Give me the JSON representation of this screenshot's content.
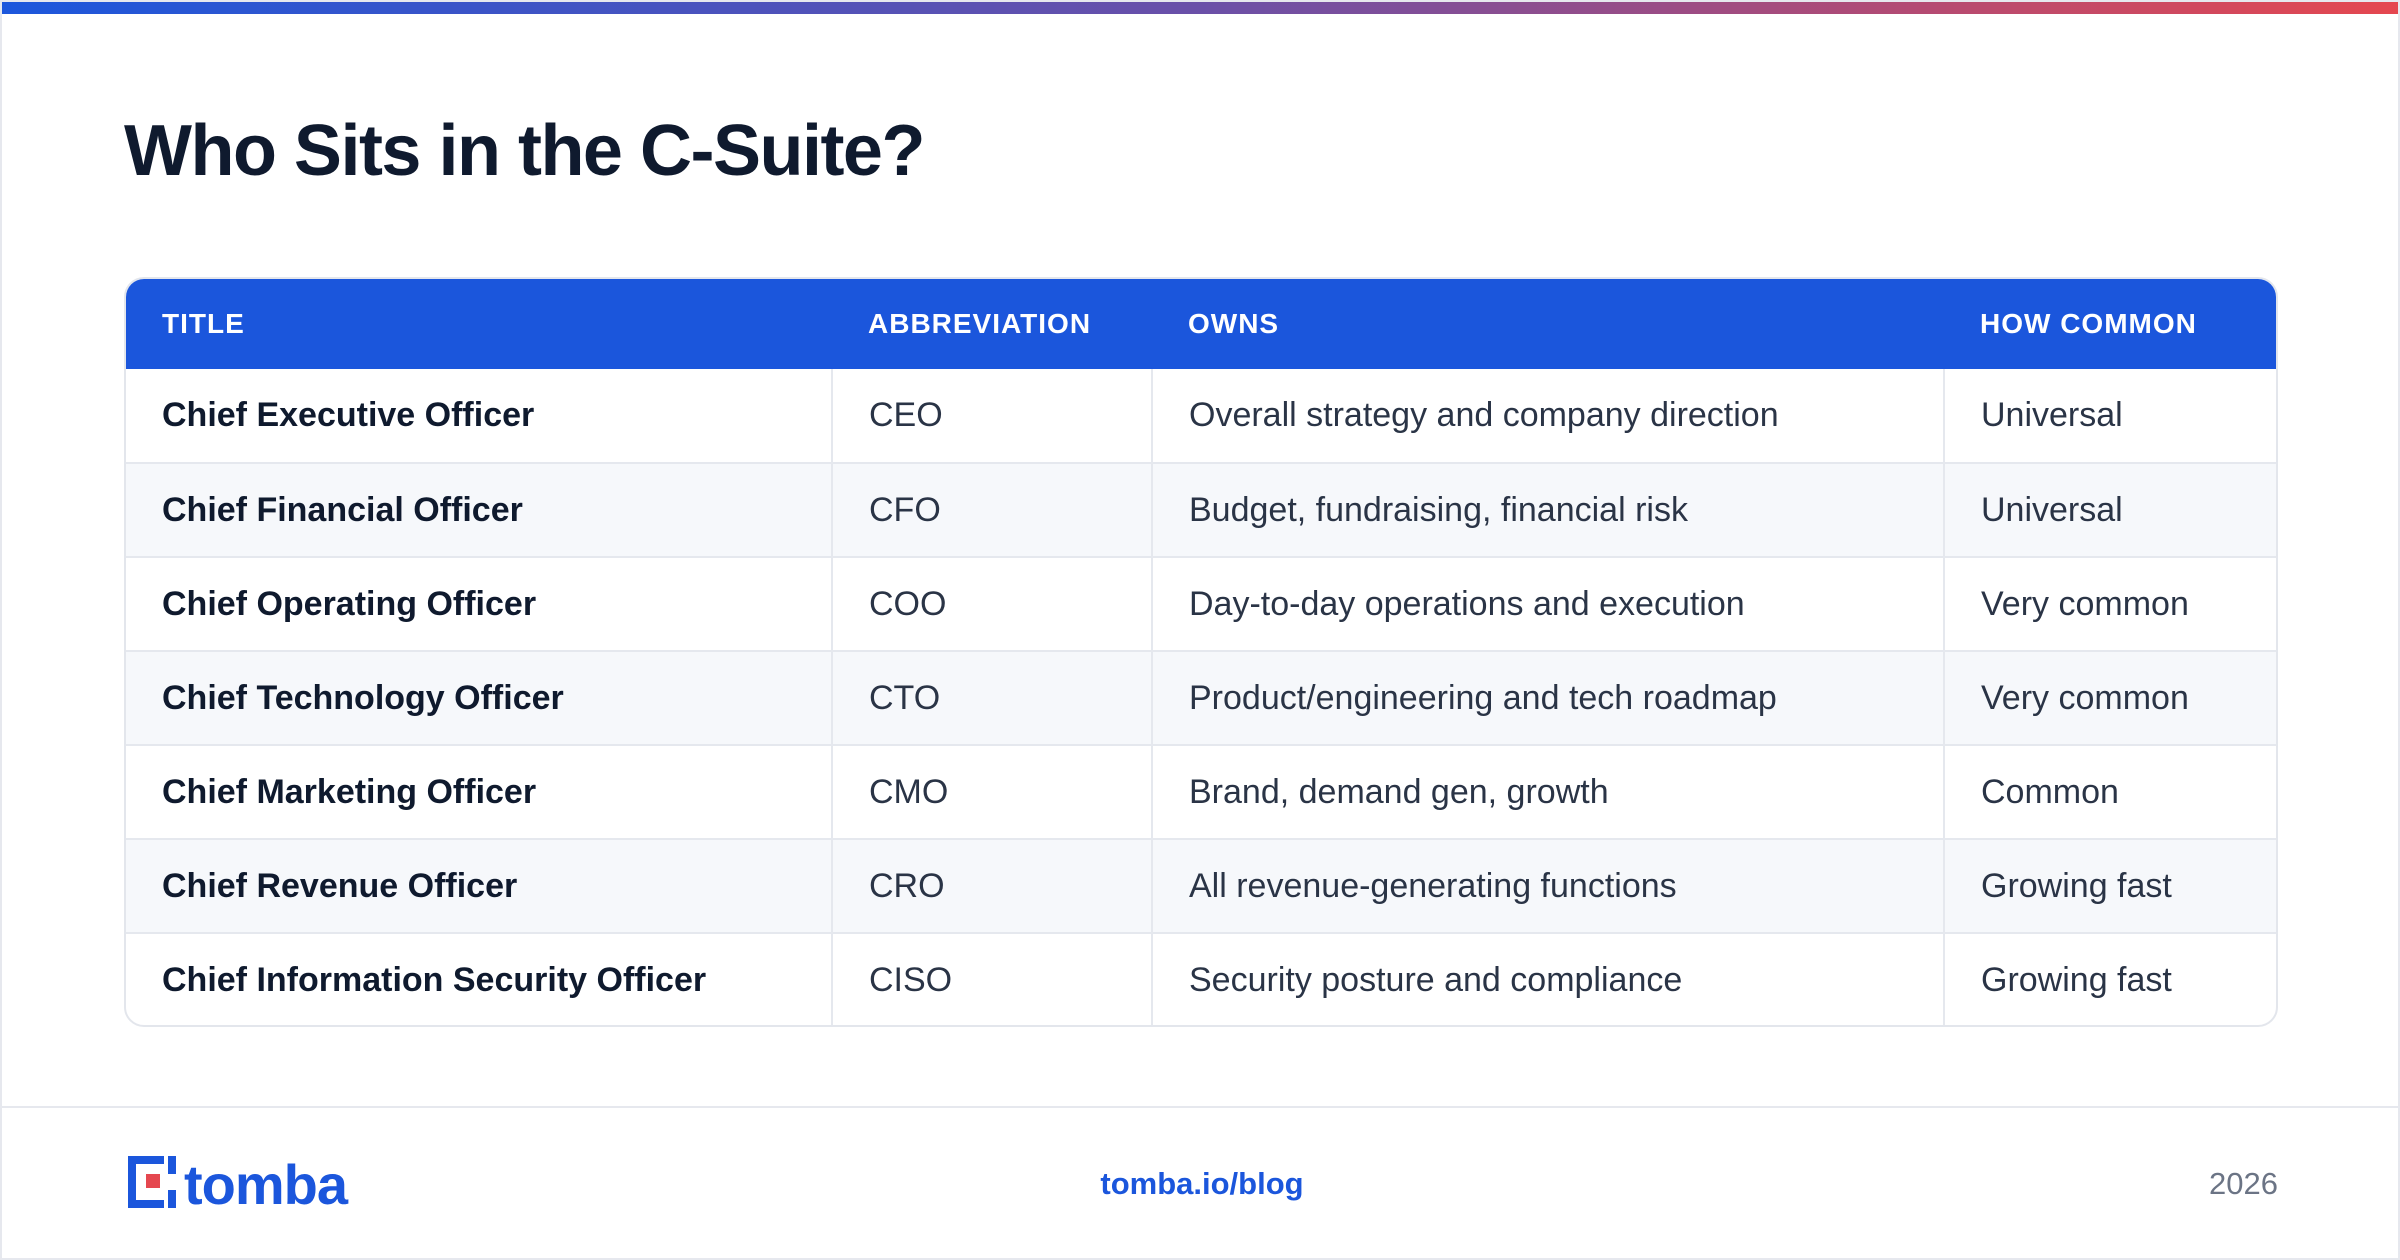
{
  "page": {
    "title": "Who Sits in the C-Suite?"
  },
  "table": {
    "headers": [
      "TITLE",
      "ABBREVIATION",
      "OWNS",
      "HOW COMMON"
    ],
    "rows": [
      {
        "title": "Chief Executive Officer",
        "abbr": "CEO",
        "owns": "Overall strategy and company direction",
        "common": "Universal"
      },
      {
        "title": "Chief Financial Officer",
        "abbr": "CFO",
        "owns": "Budget, fundraising, financial risk",
        "common": "Universal"
      },
      {
        "title": "Chief Operating Officer",
        "abbr": "COO",
        "owns": "Day-to-day operations and execution",
        "common": "Very common"
      },
      {
        "title": "Chief Technology Officer",
        "abbr": "CTO",
        "owns": "Product/engineering and tech roadmap",
        "common": "Very common"
      },
      {
        "title": "Chief Marketing Officer",
        "abbr": "CMO",
        "owns": "Brand, demand gen, growth",
        "common": "Common"
      },
      {
        "title": "Chief Revenue Officer",
        "abbr": "CRO",
        "owns": "All revenue-generating functions",
        "common": "Growing fast"
      },
      {
        "title": "Chief Information Security Officer",
        "abbr": "CISO",
        "owns": "Security posture and compliance",
        "common": "Growing fast"
      }
    ]
  },
  "footer": {
    "logo_text": "tomba",
    "link": "tomba.io/blog",
    "year": "2026"
  },
  "colors": {
    "accent": "#1b56dc",
    "brand_red": "#e5474f",
    "heading": "#0f1a2e",
    "body_text": "#2a3446",
    "muted": "#6b7485"
  }
}
